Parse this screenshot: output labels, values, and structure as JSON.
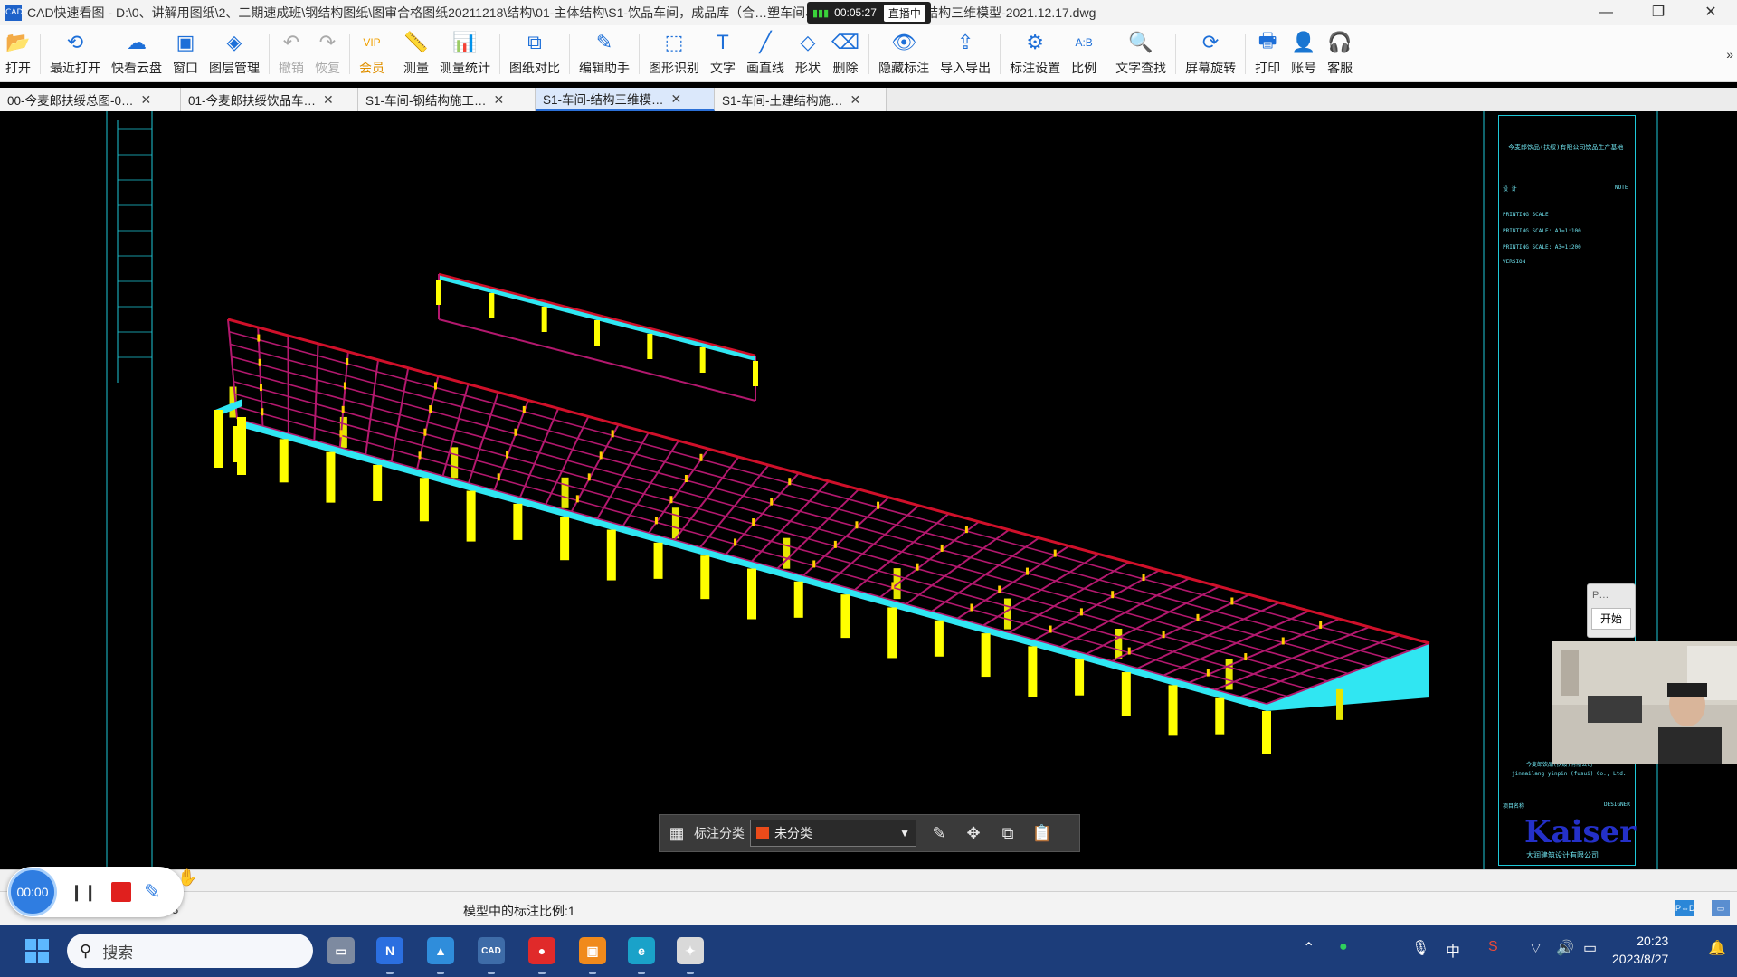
{
  "window": {
    "app_icon_text": "CAD",
    "title": "CAD快速看图 - D:\\0、讲解用图纸\\2、二期速成班\\钢结构图纸\\图审合格图纸20211218\\结构\\01-主体结构\\S1-饮品车间，成品库（合…塑车间、瓶坯车间)\\S1-车间-结构三维模型-2021.12.17.dwg",
    "controls": [
      "—",
      "❐",
      "✕"
    ]
  },
  "live": {
    "time": "00:05:27",
    "badge": "直播中"
  },
  "toolbar": [
    {
      "label": "打开",
      "icon": "folder-open-icon",
      "glyph": "📂",
      "enabled": true
    },
    {
      "label": "最近打开",
      "icon": "history-icon",
      "glyph": "⟲",
      "enabled": true
    },
    {
      "label": "快看云盘",
      "icon": "cloud-icon",
      "glyph": "☁",
      "enabled": true
    },
    {
      "label": "窗口",
      "icon": "window-icon",
      "glyph": "▣",
      "enabled": true
    },
    {
      "label": "图层管理",
      "icon": "layers-icon",
      "glyph": "◈",
      "enabled": true
    },
    {
      "label": "撤销",
      "icon": "undo-icon",
      "glyph": "↶",
      "enabled": false
    },
    {
      "label": "恢复",
      "icon": "redo-icon",
      "glyph": "↷",
      "enabled": false
    },
    {
      "label": "会员",
      "icon": "vip-icon",
      "glyph": "VIP",
      "enabled": true,
      "vip": true
    },
    {
      "label": "测量",
      "icon": "ruler-icon",
      "glyph": "📏",
      "enabled": true
    },
    {
      "label": "测量统计",
      "icon": "measure-stats-icon",
      "glyph": "📊",
      "enabled": true
    },
    {
      "label": "图纸对比",
      "icon": "compare-icon",
      "glyph": "⧉",
      "enabled": true
    },
    {
      "label": "编辑助手",
      "icon": "edit-assistant-icon",
      "glyph": "✎",
      "enabled": true
    },
    {
      "label": "图形识别",
      "icon": "shape-recognize-icon",
      "glyph": "⬚",
      "enabled": true
    },
    {
      "label": "文字",
      "icon": "text-icon",
      "glyph": "T",
      "enabled": true
    },
    {
      "label": "画直线",
      "icon": "line-icon",
      "glyph": "╱",
      "enabled": true
    },
    {
      "label": "形状",
      "icon": "shape-icon",
      "glyph": "◇",
      "enabled": true
    },
    {
      "label": "删除",
      "icon": "eraser-icon",
      "glyph": "⌫",
      "enabled": true
    },
    {
      "label": "隐藏标注",
      "icon": "hide-annotation-icon",
      "glyph": "👁",
      "enabled": true
    },
    {
      "label": "导入导出",
      "icon": "import-export-icon",
      "glyph": "⇪",
      "enabled": true
    },
    {
      "label": "标注设置",
      "icon": "annotation-settings-icon",
      "glyph": "⚙",
      "enabled": true
    },
    {
      "label": "比例",
      "icon": "scale-icon",
      "glyph": "A:B",
      "enabled": true
    },
    {
      "label": "文字查找",
      "icon": "text-search-icon",
      "glyph": "🔍",
      "enabled": true
    },
    {
      "label": "屏幕旋转",
      "icon": "rotate-screen-icon",
      "glyph": "⟳",
      "enabled": true
    },
    {
      "label": "打印",
      "icon": "printer-icon",
      "glyph": "🖶",
      "enabled": true
    },
    {
      "label": "账号",
      "icon": "account-icon",
      "glyph": "👤",
      "enabled": true
    },
    {
      "label": "客服",
      "icon": "headset-icon",
      "glyph": "🎧",
      "enabled": true
    }
  ],
  "toolbar_more": "»",
  "tabs": [
    {
      "label": "00-今麦郎扶绥总图-0…",
      "active": false
    },
    {
      "label": "01-今麦郎扶绥饮品车…",
      "active": false
    },
    {
      "label": "S1-车间-钢结构施工…",
      "active": false
    },
    {
      "label": "S1-车间-结构三维模…",
      "active": true
    },
    {
      "label": "S1-车间-土建结构施…",
      "active": false
    }
  ],
  "tab_close": "✕",
  "titleblock": {
    "lines": [
      "今麦郎饮品(扶绥)有限公司饮品生产基地",
      "设 计",
      "NOTE",
      "PRINTING SCALE",
      "PRINTING SCALE:  A1=1:100",
      "PRINTING SCALE:  A3=1:200",
      "VERSION",
      "今麦郎饮品(扶绥)有限公司",
      "jinmailang yinpin (fusui) Co., Ltd.",
      "项目名称",
      "DESIGNER"
    ],
    "logo": "Kaiser",
    "logo_sub": "大润建筑设计有限公司"
  },
  "float_panel": {
    "title": "P…",
    "button": "开始"
  },
  "annotation_bar": {
    "label": "标注分类",
    "category": "未分类",
    "category_color": "#ea4b1a"
  },
  "status": {
    "left_value": "8",
    "scale_text": "模型中的标注比例:1"
  },
  "recorder": {
    "time": "00:00"
  },
  "taskbar": {
    "search_placeholder": "搜索",
    "apps": [
      {
        "name": "task-view-icon",
        "glyph": "▭",
        "color": "#7d8aa0"
      },
      {
        "name": "onenote-icon",
        "glyph": "N",
        "color": "#2b6fe0"
      },
      {
        "name": "photos-icon",
        "glyph": "▲",
        "color": "#2f8ddb"
      },
      {
        "name": "cad-viewer-icon",
        "glyph": "CAD",
        "color": "#3e6ca8"
      },
      {
        "name": "record-app-icon",
        "glyph": "●",
        "color": "#e02a2a"
      },
      {
        "name": "media-app-icon",
        "glyph": "▣",
        "color": "#f08a1c"
      },
      {
        "name": "edge-icon",
        "glyph": "e",
        "color": "#1aa2c9"
      },
      {
        "name": "paint-app-icon",
        "glyph": "✦",
        "color": "#d9d9d9"
      }
    ],
    "tray": {
      "ime": "中",
      "time": "20:23",
      "date": "2023/8/27"
    }
  }
}
